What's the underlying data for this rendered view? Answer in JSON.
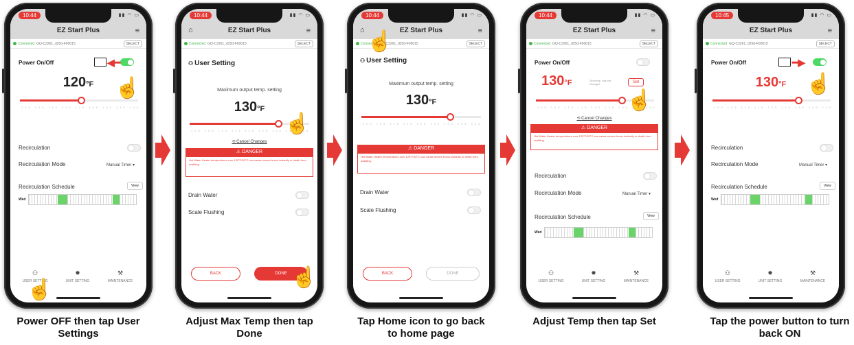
{
  "app": {
    "title": "EZ Start Plus",
    "connected_label": "Connected",
    "device_id": "GQ-C3261_d25d-F00015",
    "select_label": "SELECT"
  },
  "phones": [
    {
      "time": "10:44",
      "power_label": "Power On/Off",
      "power_state": "on",
      "temp_value": "120",
      "temp_unit": "°F",
      "recirculation_label": "Recirculation",
      "recirculation_mode_label": "Recirculation Mode",
      "recirculation_mode_value": "Manual Timer ▾",
      "recirculation_schedule_label": "Recirculation Schedule",
      "view_label": "View",
      "schedule_day": "Wed",
      "caption": "Power OFF then tap User Settings"
    },
    {
      "time": "10:44",
      "section_title": "User Setting",
      "max_output_label": "Maximum output temp. setting",
      "temp_value": "130",
      "temp_unit": "°F",
      "cancel_changes_label": "Cancel Changes",
      "danger_label": "DANGER",
      "danger_text": "Hot Water Heater temperatures over 125°F/52°C can cause severe burns instantly or death from scalding.",
      "drain_water_label": "Drain Water",
      "scale_flushing_label": "Scale Flushing",
      "back_label": "BACK",
      "done_label": "DONE",
      "caption": "Adjust Max Temp then tap Done"
    },
    {
      "time": "10:44",
      "section_title": "User Setting",
      "max_output_label": "Maximum output temp. setting",
      "temp_value": "130",
      "temp_unit": "°F",
      "danger_label": "DANGER",
      "danger_text": "Hot Water Heater temperatures over 125°F/52°C can cause severe burns instantly or death from scalding.",
      "drain_water_label": "Drain Water",
      "scale_flushing_label": "Scale Flushing",
      "back_label": "BACK",
      "done_label": "DONE",
      "caption": "Tap Home icon to go back to home page"
    },
    {
      "time": "10:44",
      "power_label": "Power On/Off",
      "power_state": "off",
      "temp_value": "130",
      "temp_unit": "°F",
      "set_hint": "Set temp. has not changed",
      "set_label": "Set",
      "cancel_changes_label": "Cancel Changes",
      "danger_label": "DANGER",
      "danger_text": "Hot Water Heater temperatures over 125°F/52°C can cause severe burns instantly or death from scalding.",
      "recirculation_label": "Recirculation",
      "recirculation_mode_label": "Recirculation Mode",
      "recirculation_mode_value": "Manual Timer ▾",
      "recirculation_schedule_label": "Recirculation Schedule",
      "view_label": "View",
      "schedule_day": "Wed",
      "caption": "Adjust Temp then tap Set"
    },
    {
      "time": "10:45",
      "power_label": "Power On/Off",
      "power_state": "on",
      "temp_value": "130",
      "temp_unit": "°F",
      "recirculation_label": "Recirculation",
      "recirculation_mode_label": "Recirculation Mode",
      "recirculation_mode_value": "Manual Timer ▾",
      "recirculation_schedule_label": "Recirculation Schedule",
      "view_label": "View",
      "schedule_day": "Wed",
      "caption": "Tap the power button to turn back ON"
    }
  ],
  "tabs": {
    "user_setting": "USER SETTING",
    "unit_setting": "UNIT SETTING",
    "maintenance": "MAINTENANCE"
  },
  "icons": {
    "menu": "menu-icon",
    "home": "home-icon",
    "hand": "hand-pointer-icon",
    "step_arrow": "red-right-arrow-icon"
  },
  "colors": {
    "accent": "#e53935",
    "toggle_on": "#4cd964",
    "connected": "#43b649",
    "schedule_on": "#6ad46a"
  }
}
